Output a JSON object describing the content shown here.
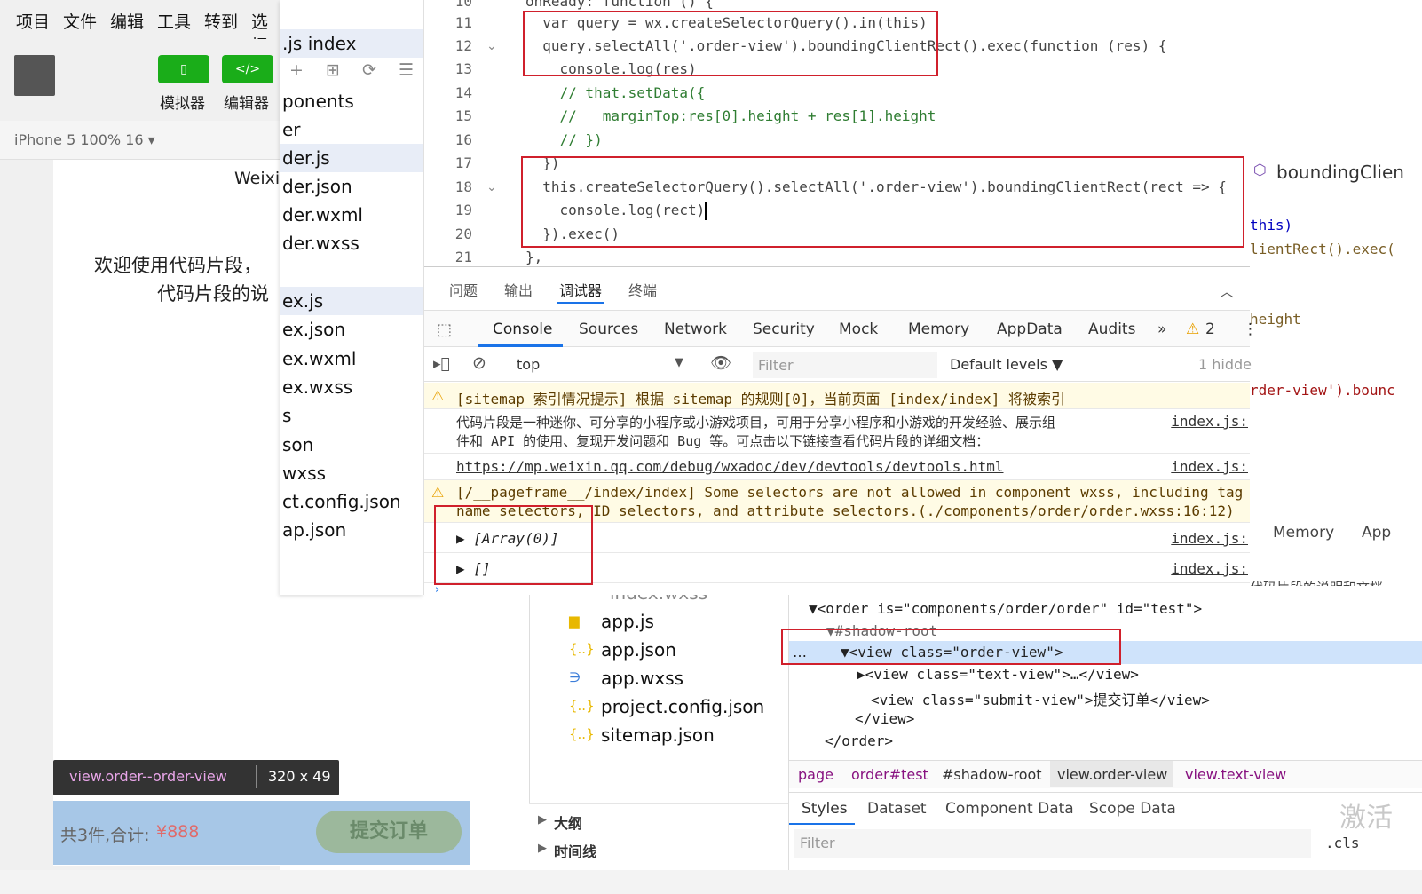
{
  "menu": {
    "items": [
      "项目",
      "文件",
      "编辑",
      "工具",
      "转到",
      "选择"
    ]
  },
  "toolbar": {
    "simulator_label": "模拟器",
    "editor_label": "编辑器",
    "simulator_icon": "phone-icon",
    "editor_icon": "code-icon"
  },
  "device": {
    "label": "iPhone 5 100% 16 ▾"
  },
  "phone": {
    "header_text": "Weixin",
    "welcome_line1": "欢迎使用代码片段，",
    "welcome_line2": "代码片段的说",
    "tooltip_selector": "view.order--order-view",
    "tooltip_size": "320 x 49",
    "total_text": "共3件,合计:",
    "price": "¥888",
    "submit_button": "提交订单"
  },
  "front_files": {
    "items": [
      ".js  index",
      "ponents",
      "er",
      "der.js",
      "der.json",
      "der.wxml",
      "der.wxss",
      "",
      "ex.js",
      "ex.json",
      "ex.wxml",
      "ex.wxss",
      "s",
      "son",
      "wxss",
      "ct.config.json",
      "ap.json"
    ]
  },
  "editor": {
    "lines": [
      {
        "num": "10",
        "text": "onReady: function () {"
      },
      {
        "num": "11",
        "text": "  var query = wx.createSelectorQuery().in(this)"
      },
      {
        "num": "12",
        "text": "  query.selectAll('.order-view').boundingClientRect().exec(function (res) {"
      },
      {
        "num": "13",
        "text": "    console.log(res)"
      },
      {
        "num": "14",
        "text": "    // that.setData({"
      },
      {
        "num": "15",
        "text": "    //   marginTop:res[0].height + res[1].height"
      },
      {
        "num": "16",
        "text": "    // })"
      },
      {
        "num": "17",
        "text": "  })"
      },
      {
        "num": "18",
        "text": "  this.createSelectorQuery().selectAll('.order-view').boundingClientRect(rect => {"
      },
      {
        "num": "19",
        "text": "    console.log(rect)"
      },
      {
        "num": "20",
        "text": "  }).exec()"
      },
      {
        "num": "21",
        "text": "},"
      }
    ]
  },
  "panel_tabs": [
    "问题",
    "输出",
    "调试器",
    "终端"
  ],
  "devtools_tabs": [
    "Console",
    "Sources",
    "Network",
    "Security",
    "Mock",
    "Memory",
    "AppData",
    "Audits"
  ],
  "warn_count": "2",
  "console_toolbar": {
    "context": "top",
    "filter_placeholder": "Filter",
    "levels": "Default levels ▼",
    "hidden": "1 hidde"
  },
  "console": {
    "sitemap": "[sitemap 索引情况提示] 根据 sitemap 的规则[0]，当前页面 [index/index] 将被索引",
    "intro1": "代码片段是一种迷你、可分享的小程序或小游戏项目，可用于分享小程序和小游戏的开发经验、展示组",
    "intro2": "件和 API 的使用、复现开发问题和 Bug 等。可点击以下链接查看代码片段的详细文档：",
    "url": "https://mp.weixin.qq.com/debug/wxadoc/dev/devtools/devtools.html",
    "pageframe1": "[/__pageframe__/index/index] Some selectors are not allowed in component wxss, including tag",
    "pageframe2": "name selectors, ID selectors, and attribute selectors.(./components/order/order.wxss:16:12)",
    "array": "▶ [Array(0)]",
    "empty": "▶ []",
    "source": "index.js:"
  },
  "back_files": {
    "items": [
      "index.wxss",
      "app.js",
      "app.json",
      "app.wxss",
      "project.config.json",
      "sitemap.json"
    ]
  },
  "outline": {
    "items": [
      "大纲",
      "时间线"
    ]
  },
  "back_editor_right": {
    "header": "boundingClien",
    "line1": "this)",
    "line2": "lientRect().exec(",
    "line3": "height",
    "line4": "rder-view').bounc"
  },
  "back_dev_tabs": [
    "Memory",
    "App"
  ],
  "back_desc": "代码片段的说明和文档",
  "dom": {
    "l1": "▼<order is=\"components/order/order\" id=\"test\">",
    "l2": "▼#shadow-root",
    "l3": "▼<view class=\"order-view\">",
    "l4": "▶<view class=\"text-view\">…</view>",
    "l5": "<view class=\"submit-view\">提交订单</view>",
    "l6": "</view>",
    "l7": "</order>"
  },
  "breadcrumbs": [
    "page",
    "order#test",
    "#shadow-root",
    "view.order-view",
    "view.text-view"
  ],
  "styles_tabs": [
    "Styles",
    "Dataset",
    "Component Data",
    "Scope Data"
  ],
  "styles_filter": "Filter",
  "cls": ".cls",
  "watermark": "激活",
  "colors": {
    "accent": "#1aad19",
    "red_box": "#d0202c",
    "selected_blue": "#1a73e8"
  }
}
